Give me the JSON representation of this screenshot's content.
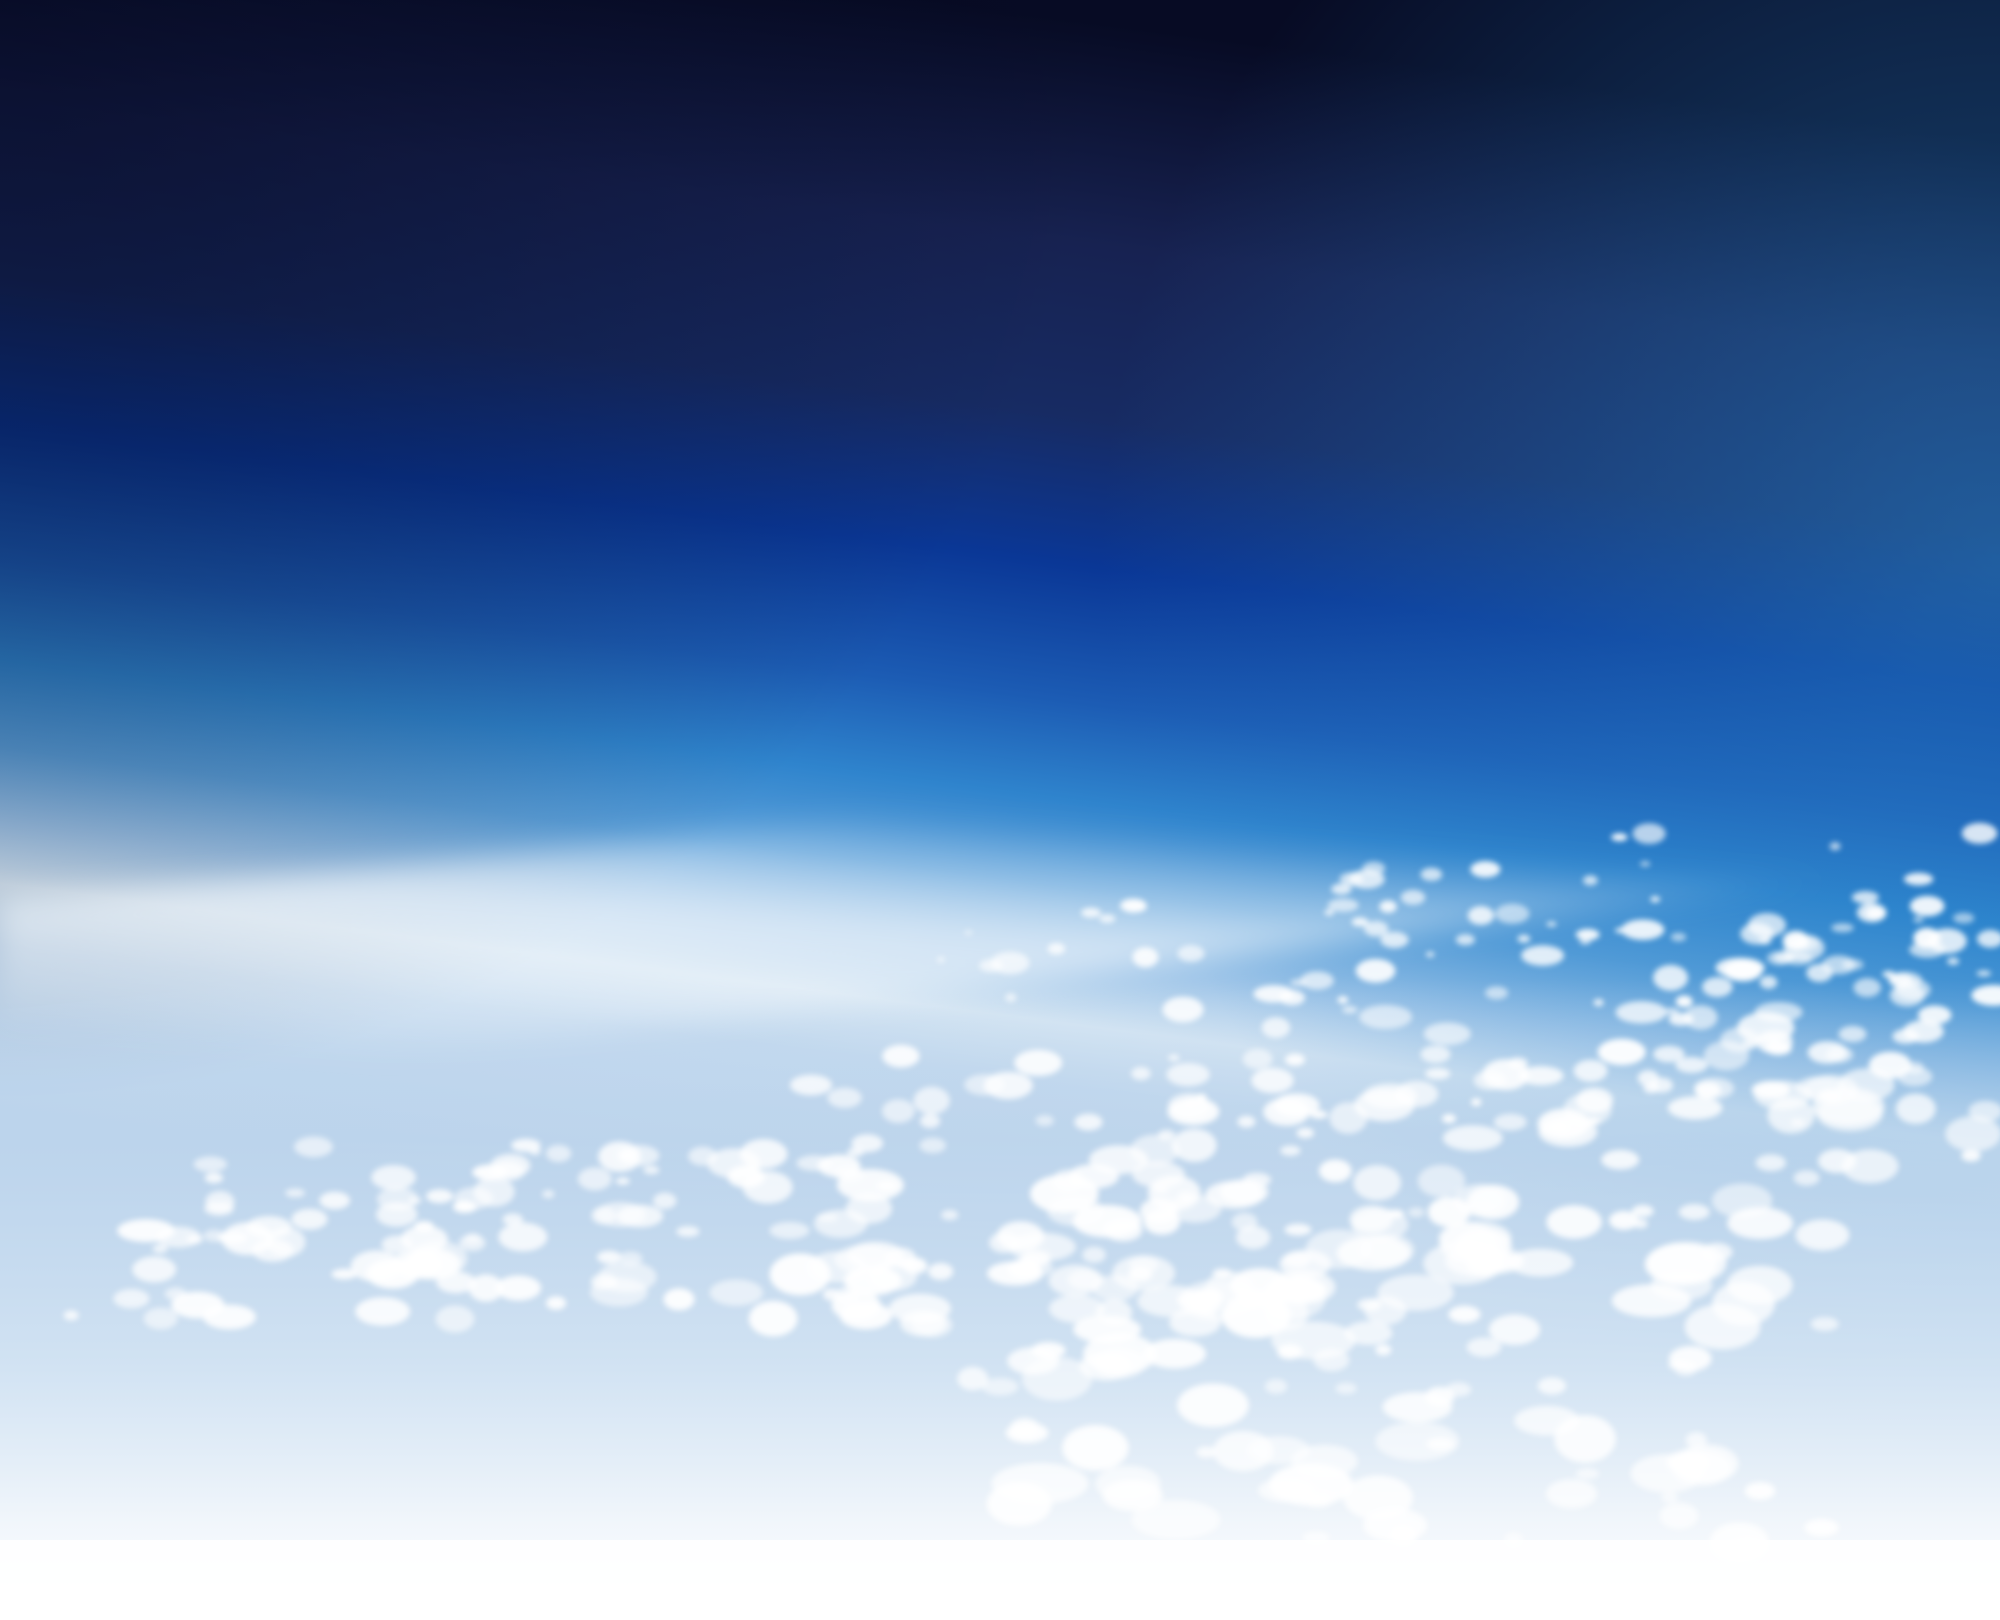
{
  "scene": {
    "subject": "earth-horizon-from-stratosphere",
    "colors": {
      "space_dark": "#070b24",
      "upper_sky": "#1a2a5e",
      "deep_blue": "#0a3796",
      "mid_blue": "#1f6cbd",
      "limb_blue": "#4d98d8",
      "haze": "#d6e6f3",
      "earth_surface": "#bed6ee",
      "cloud_white": "#ffffff",
      "bottom_fade": "#ffffff"
    }
  }
}
